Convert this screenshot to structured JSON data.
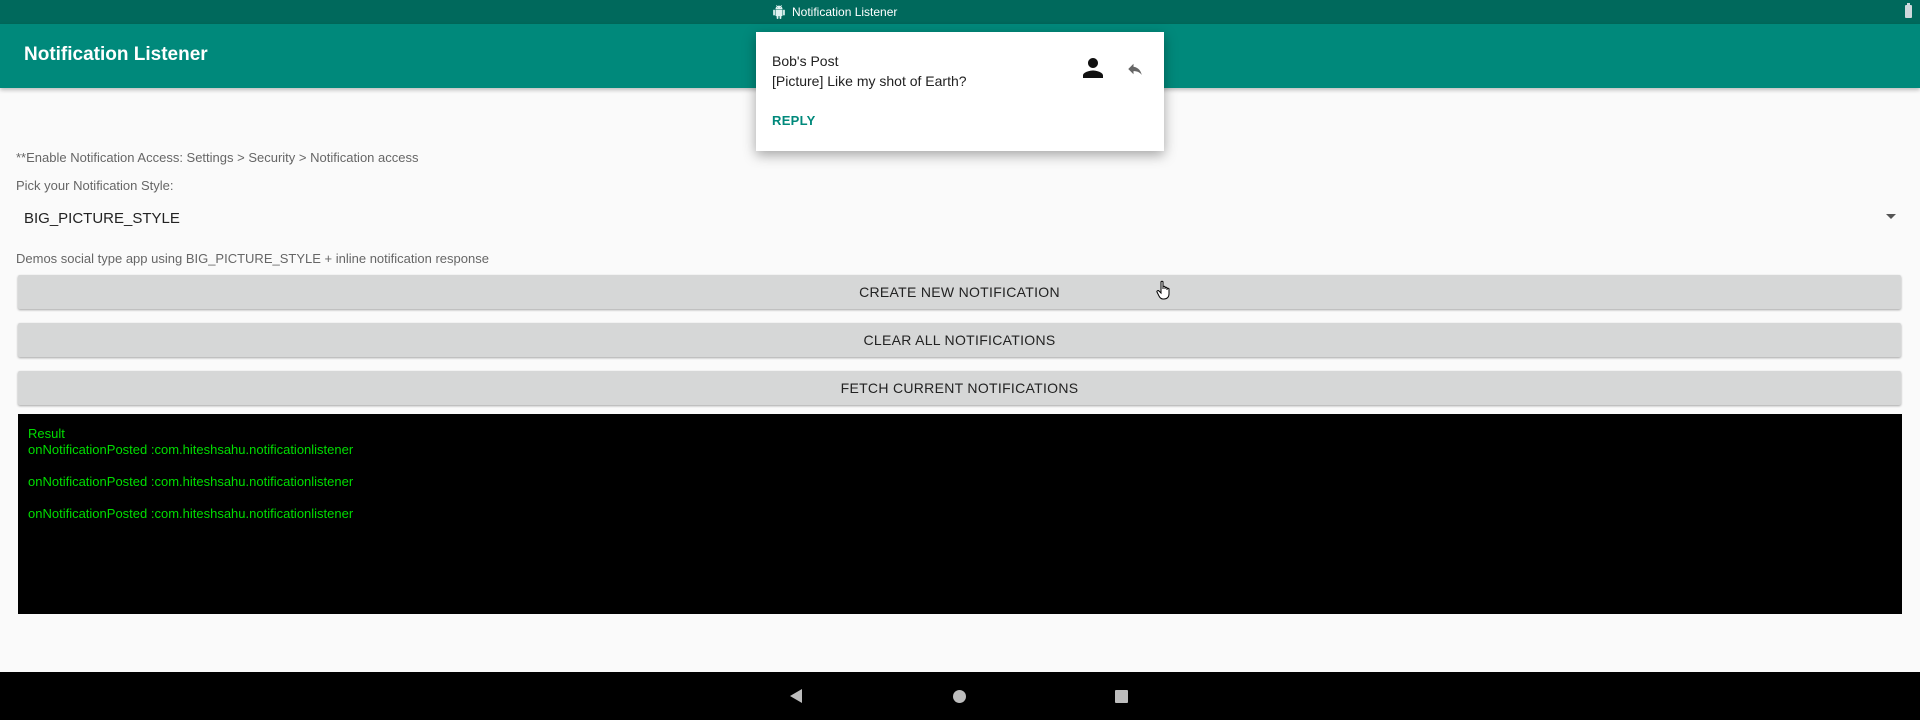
{
  "status_bar": {
    "title": "Notification Listener",
    "android_icon": "android-icon",
    "battery_icon": "battery-icon"
  },
  "app_bar": {
    "title": "Notification Listener",
    "background": "#00897b"
  },
  "main": {
    "hint": "**Enable Notification Access: Settings > Security > Notification access",
    "pick_label": "Pick your Notification Style:",
    "style_select": {
      "selected": "BIG_PICTURE_STYLE"
    },
    "description": "Demos social type app using BIG_PICTURE_STYLE + inline notification response",
    "buttons": {
      "create": "CREATE NEW NOTIFICATION",
      "clear": "CLEAR ALL NOTIFICATIONS",
      "fetch": "FETCH CURRENT NOTIFICATIONS"
    },
    "result": {
      "title": "Result",
      "lines": [
        "onNotificationPosted :com.hiteshsahu.notificationlistener",
        "onNotificationPosted :com.hiteshsahu.notificationlistener",
        "onNotificationPosted :com.hiteshsahu.notificationlistener"
      ],
      "text_color": "#00dd00"
    }
  },
  "notification": {
    "title": "Bob's Post",
    "text": "[Picture] Like my shot of Earth?",
    "action_label": "REPLY",
    "accent": "#00897b",
    "person_icon": "person-icon",
    "reply_icon": "reply-icon"
  },
  "nav_bar": {
    "back_icon": "back-icon",
    "home_icon": "home-icon",
    "recents_icon": "recents-icon"
  }
}
